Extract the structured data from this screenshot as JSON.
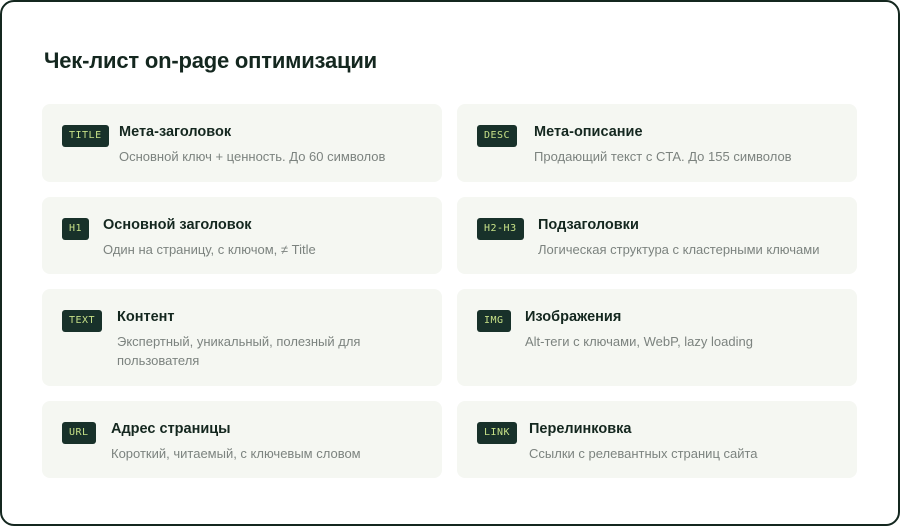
{
  "page": {
    "title": "Чек-лист on-page оптимизации"
  },
  "colors": {
    "frame_border": "#14271f",
    "card_background": "#f5f7f2",
    "tag_background": "#18312a",
    "tag_text": "#c6e087",
    "title_text": "#14271f",
    "description_text": "#7c837f"
  },
  "items": [
    {
      "tag": "TITLE",
      "title": "Мета-заголовок",
      "description": "Основной ключ + ценность. До 60 символов"
    },
    {
      "tag": "DESC",
      "title": "Мета-описание",
      "description": "Продающий текст с CTA. До 155 символов"
    },
    {
      "tag": "H1",
      "title": "Основной заголовок",
      "description": "Один на страницу, с ключом, ≠ Title"
    },
    {
      "tag": "H2-H3",
      "title": "Подзаголовки",
      "description": "Логическая структура с кластерными ключами"
    },
    {
      "tag": "TEXT",
      "title": "Контент",
      "description": "Экспертный, уникальный, полезный для пользователя"
    },
    {
      "tag": "IMG",
      "title": "Изображения",
      "description": "Alt-теги с ключами, WebP, lazy loading"
    },
    {
      "tag": "URL",
      "title": "Адрес страницы",
      "description": "Короткий, читаемый, с ключевым словом"
    },
    {
      "tag": "LINK",
      "title": "Перелинковка",
      "description": "Ссылки с релевантных страниц сайта"
    }
  ]
}
